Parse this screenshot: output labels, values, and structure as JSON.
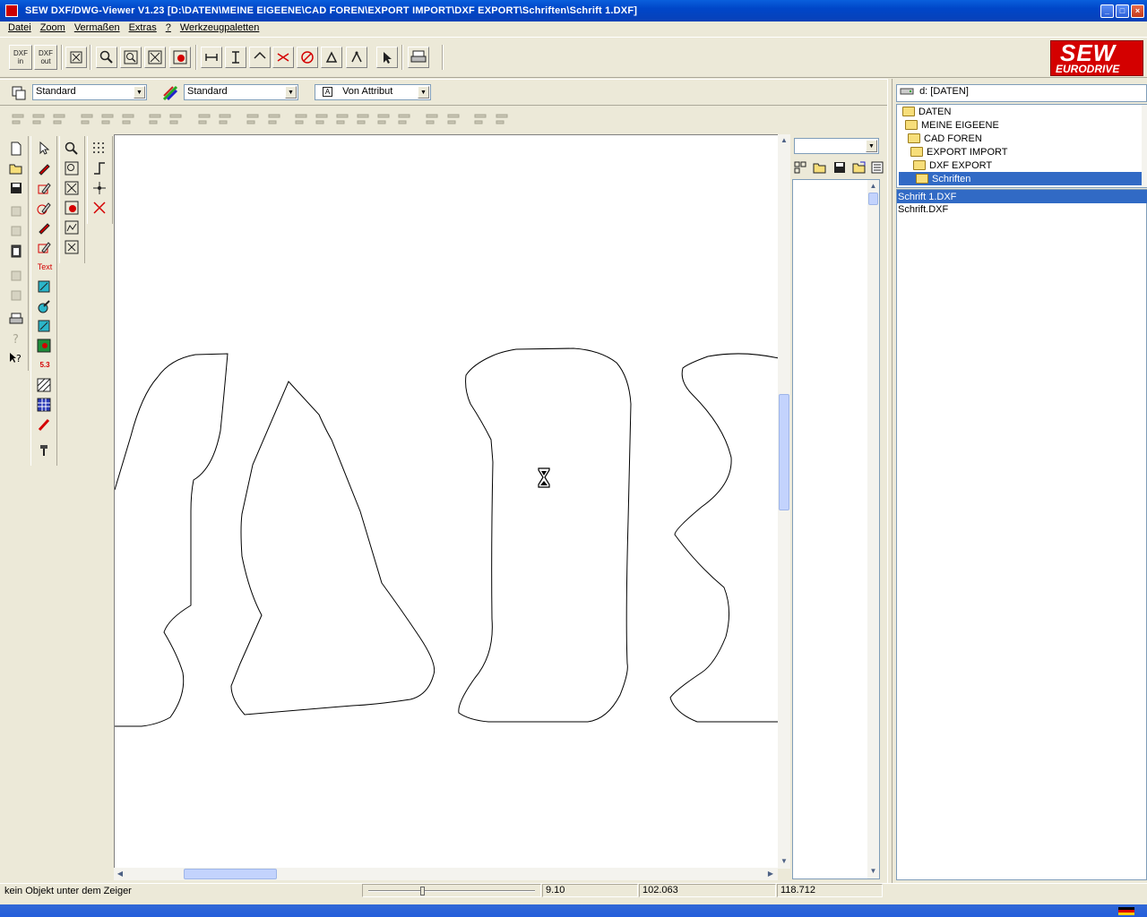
{
  "window": {
    "title": "SEW DXF/DWG-Viewer V1.23 [D:\\DATEN\\MEINE EIGEENE\\CAD FOREN\\EXPORT IMPORT\\DXF EXPORT\\Schriften\\Schrift 1.DXF]",
    "minimize": "_",
    "maximize": "□",
    "close": "×"
  },
  "menu": [
    "Datei",
    "Zoom",
    "Vermaßen",
    "Extras",
    "?",
    "Werkzeugpaletten"
  ],
  "toolbar": {
    "dxf_in": "DXF in",
    "dxf_out": "DXF out",
    "logo_text": "SEW",
    "logo_sub": "EURODRIVE"
  },
  "properties": {
    "layer_value": "Standard",
    "linetype_value": "Standard",
    "text_style_value": "Von Attribut",
    "text_style_icon": "A"
  },
  "palette": {
    "text_tool": "Text",
    "dim_tool": "5.3"
  },
  "side_panel": {
    "combo_value": ""
  },
  "drive": {
    "label": "d: [DATEN]"
  },
  "tree": [
    {
      "label": "DATEN",
      "selected": false
    },
    {
      "label": "MEINE EIGEENE",
      "selected": false
    },
    {
      "label": "CAD FOREN",
      "selected": false
    },
    {
      "label": "EXPORT IMPORT",
      "selected": false
    },
    {
      "label": "DXF EXPORT",
      "selected": false
    },
    {
      "label": "Schriften",
      "selected": true
    }
  ],
  "files": [
    {
      "label": "Schrift 1.DXF",
      "selected": true
    },
    {
      "label": "Schrift.DXF",
      "selected": false
    }
  ],
  "status": {
    "message": "kein Objekt unter dem Zeiger",
    "zoom": "9.10",
    "x": "102.063",
    "y": "118.712"
  },
  "colors": {
    "titlebar": "#0046c8",
    "selection": "#316ac5",
    "logo": "#d40000"
  }
}
